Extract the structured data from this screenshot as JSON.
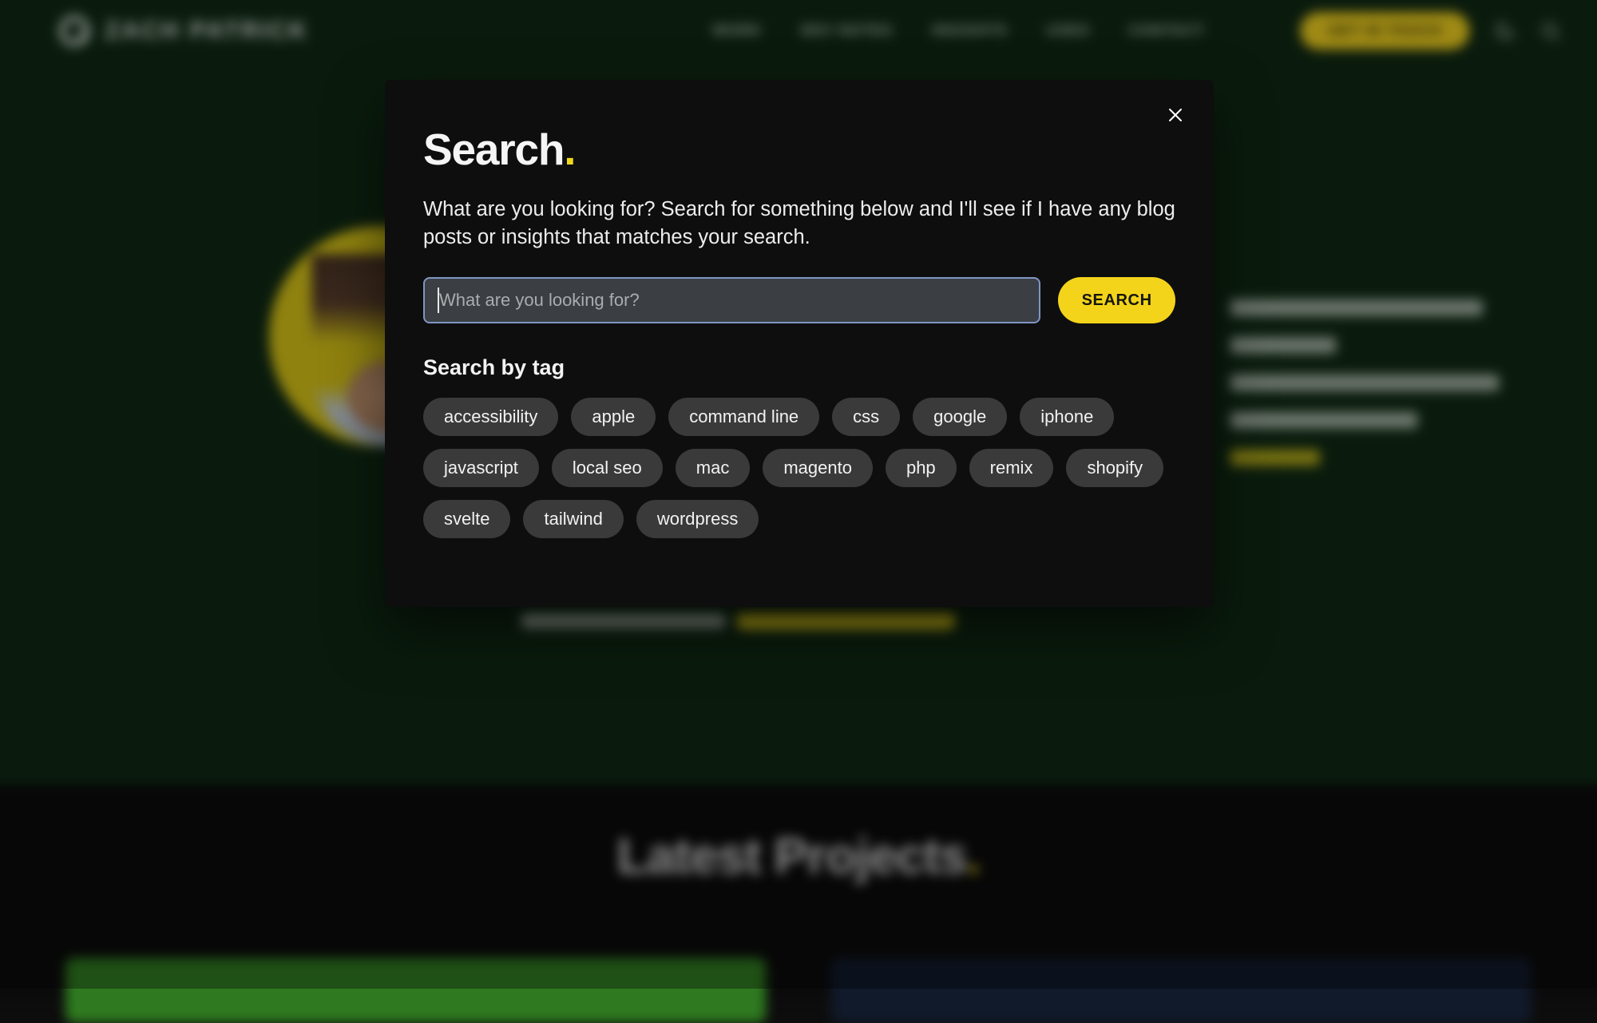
{
  "header": {
    "brand_name": "ZACH PATRICK",
    "nav_items": [
      {
        "label": "WORK"
      },
      {
        "label": "DEV NOTES"
      },
      {
        "label": "INSIGHTS"
      },
      {
        "label": "USES"
      },
      {
        "label": "CONTACT"
      }
    ],
    "cta_label": "GET IN TOUCH",
    "theme_toggle_icon": "moon-icon",
    "search_icon": "search-icon"
  },
  "background": {
    "latest_projects_title": "Latest Projects",
    "latest_projects_dot": "."
  },
  "modal": {
    "close_icon": "close-icon",
    "title": "Search",
    "title_dot": ".",
    "description": "What are you looking for? Search for something below and I'll see if I have any blog posts or insights that matches your search.",
    "search": {
      "placeholder": "What are you looking for?",
      "value": "",
      "button_label": "SEARCH"
    },
    "tags_heading": "Search by tag",
    "tags": [
      {
        "label": "accessibility"
      },
      {
        "label": "apple"
      },
      {
        "label": "command line"
      },
      {
        "label": "css"
      },
      {
        "label": "google"
      },
      {
        "label": "iphone"
      },
      {
        "label": "javascript"
      },
      {
        "label": "local seo"
      },
      {
        "label": "mac"
      },
      {
        "label": "magento"
      },
      {
        "label": "php"
      },
      {
        "label": "remix"
      },
      {
        "label": "shopify"
      },
      {
        "label": "svelte"
      },
      {
        "label": "tailwind"
      },
      {
        "label": "wordpress"
      }
    ]
  },
  "colors": {
    "accent_yellow": "#f4d41b",
    "page_green": "#102a15",
    "modal_bg": "#0e0e0e",
    "tag_bg": "#3a3a3a",
    "focus_ring": "#7f96c4"
  }
}
